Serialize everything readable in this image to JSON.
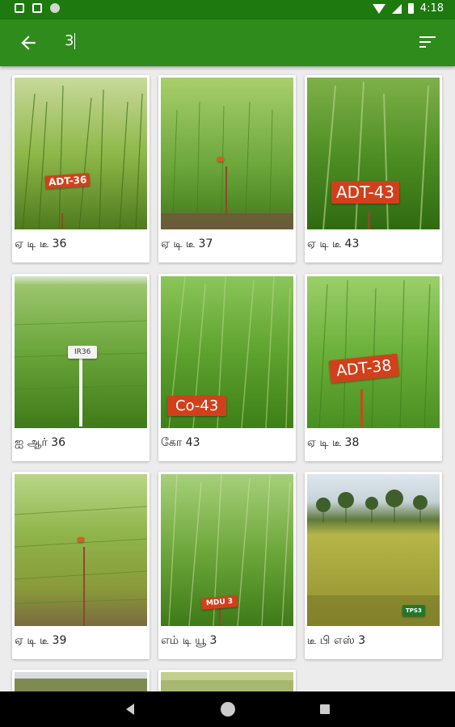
{
  "status_bar": {
    "time": "4:18"
  },
  "toolbar": {
    "search_value": "3",
    "back_icon": "arrow-back-icon",
    "filter_icon": "sort-icon"
  },
  "colors": {
    "toolbar": "#2f8b1c",
    "status_bar": "#1e7a0f",
    "sign_red": "#d2401b"
  },
  "varieties": [
    {
      "label": "ஏ டி டீ 36",
      "sign": "ADT-36"
    },
    {
      "label": "ஏ டி டீ 37",
      "sign": ""
    },
    {
      "label": "ஏ டி டீ 43",
      "sign": "ADT-43"
    },
    {
      "label": "ஐ ஆர் 36",
      "sign": "IR36"
    },
    {
      "label": "கோ 43",
      "sign": "Co-43"
    },
    {
      "label": "ஏ டி டீ 38",
      "sign": "ADT-38"
    },
    {
      "label": "ஏ டி டீ 39",
      "sign": ""
    },
    {
      "label": "எம் டி யூ 3",
      "sign": "MDU 3"
    },
    {
      "label": "டீ பி எஸ் 3",
      "sign": "TPS3"
    }
  ]
}
